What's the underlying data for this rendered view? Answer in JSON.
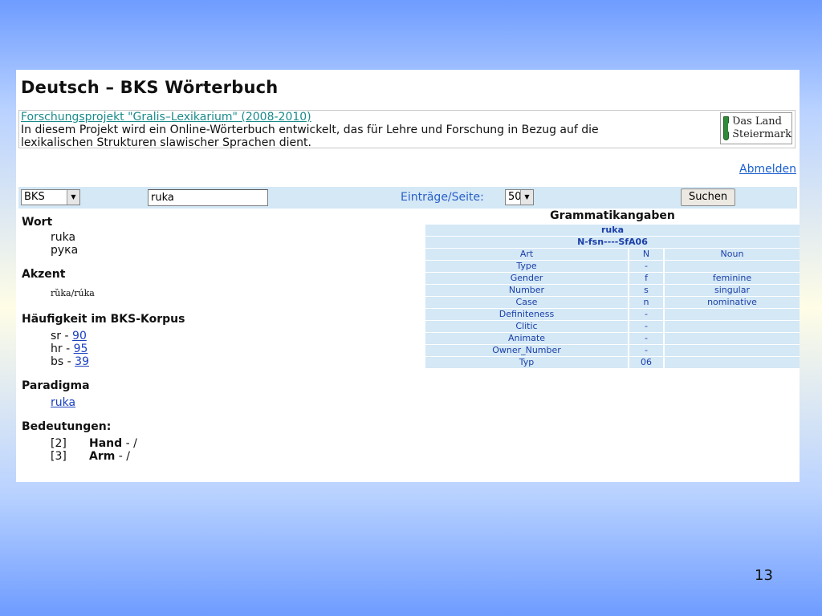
{
  "title": "Deutsch – BKS Wörterbuch",
  "project": {
    "link": "Forschungsprojekt \"Gralis–Lexikarium\" (2008-2010)",
    "description": "In diesem Projekt wird ein Online-Wörterbuch entwickelt, das für Lehre und Forschung in Bezug auf die lexikalischen Strukturen slawischer Sprachen dient.",
    "logo_line1": "Das Land",
    "logo_line2": "Steiermark"
  },
  "abmelden": "Abmelden",
  "search": {
    "language": "BKS",
    "query": "ruka",
    "per_page_label": "Einträge/Seite:",
    "per_page": "50",
    "button": "Suchen"
  },
  "wort": {
    "heading": "Wort",
    "latin": "ruka",
    "cyrillic": "рука"
  },
  "akzent": {
    "heading": "Akzent",
    "value": "rȕka/rúka"
  },
  "haeufigkeit": {
    "heading": "Häufigkeit im BKS-Korpus",
    "items": [
      {
        "lang": "sr",
        "sep": "-",
        "count": "90"
      },
      {
        "lang": "hr",
        "sep": "-",
        "count": "95"
      },
      {
        "lang": "bs",
        "sep": "-",
        "count": "39"
      }
    ]
  },
  "paradigma": {
    "heading": "Paradigma",
    "link": "ruka"
  },
  "bedeutungen": {
    "heading": "Bedeutungen:",
    "items": [
      {
        "num": "[2]",
        "word": "Hand",
        "rest": "- /"
      },
      {
        "num": "[3]",
        "word": "Arm",
        "rest": "- /"
      }
    ]
  },
  "grammatik": {
    "heading": "Grammatikangaben",
    "word": "ruka",
    "code": "N-fsn----SfA06",
    "rows": [
      [
        "Art",
        "N",
        "Noun"
      ],
      [
        "Type",
        "-",
        ""
      ],
      [
        "Gender",
        "f",
        "feminine"
      ],
      [
        "Number",
        "s",
        "singular"
      ],
      [
        "Case",
        "n",
        "nominative"
      ],
      [
        "Definiteness",
        "-",
        ""
      ],
      [
        "Clitic",
        "-",
        ""
      ],
      [
        "Animate",
        "-",
        ""
      ],
      [
        "Owner_Number",
        "-",
        ""
      ],
      [
        "Typ",
        "06",
        ""
      ]
    ]
  },
  "slide_number": "13"
}
